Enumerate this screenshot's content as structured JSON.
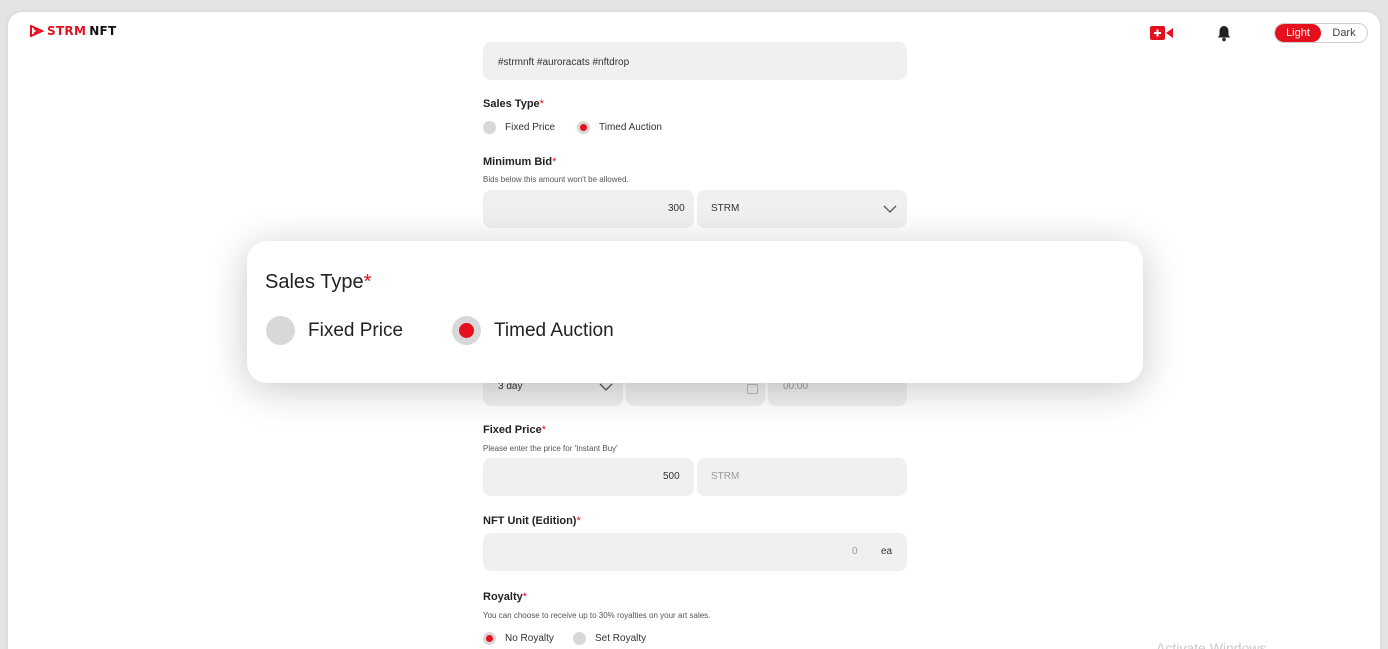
{
  "header": {
    "logo_strm": "STRM",
    "logo_nft": "NFT",
    "theme": {
      "light": "Light",
      "dark": "Dark",
      "active": "light"
    }
  },
  "colors": {
    "accent": "#e5101d",
    "field_bg": "#f0f0f0",
    "radio_off": "#d8d8d8"
  },
  "icons": [
    "logo-mark-icon",
    "video-icon",
    "bell-icon",
    "chevron-down-icon",
    "calendar-icon"
  ],
  "form": {
    "tags_value": "#strmnft #auroracats #nftdrop",
    "sales_type": {
      "label": "Sales Type",
      "required": "*",
      "options": [
        "Fixed Price",
        "Timed Auction"
      ],
      "selected": "Timed Auction"
    },
    "minimum_bid": {
      "label": "Minimum Bid",
      "required": "*",
      "hint": "Bids below this amount won't be allowed.",
      "value": "300",
      "currency": "STRM"
    },
    "duration": {
      "value": "3 day",
      "time": "00:00"
    },
    "fixed_price": {
      "label": "Fixed Price",
      "required": "*",
      "hint": "Please enter the price for 'Instant Buy'",
      "value": "500",
      "currency": "STRM"
    },
    "nft_unit": {
      "label": "NFT Unit (Edition)",
      "required": "*",
      "value": "0",
      "unit": "ea"
    },
    "royalty": {
      "label": "Royalty",
      "required": "*",
      "hint": "You can choose to receive up to 30% royalties on your art sales.",
      "options": [
        "No Royalty",
        "Set Royalty"
      ],
      "selected": "No Royalty"
    }
  },
  "zoom_overlay": {
    "title": "Sales Type",
    "required": "*",
    "options": [
      "Fixed Price",
      "Timed Auction"
    ],
    "selected": "Timed Auction"
  },
  "watermark": "Activate Windows"
}
